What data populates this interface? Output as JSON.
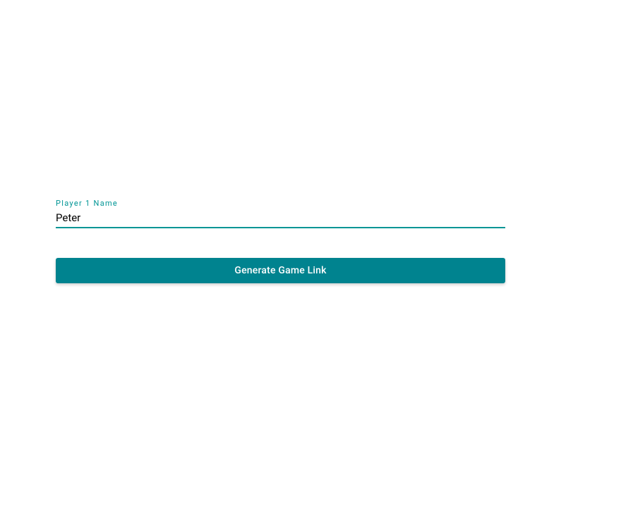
{
  "form": {
    "player_name_label": "Player 1 Name",
    "player_name_value": "Peter",
    "generate_button_label": "Generate Game Link"
  },
  "colors": {
    "accent": "#009595",
    "button_bg": "#00838f"
  }
}
